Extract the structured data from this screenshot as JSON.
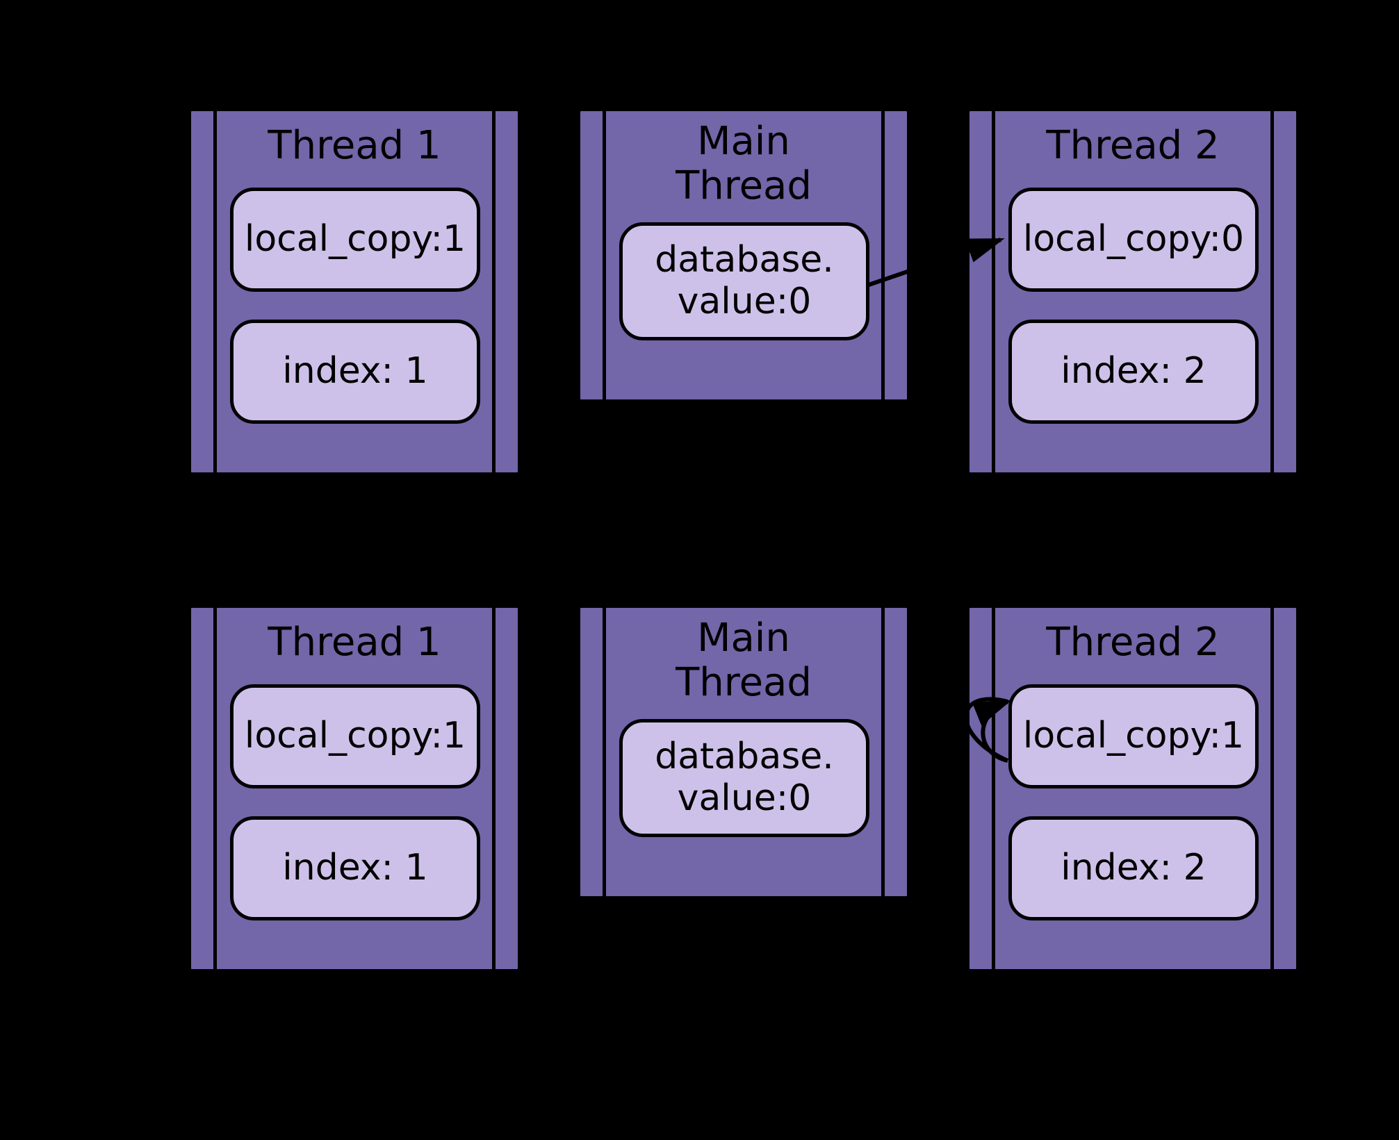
{
  "rows": [
    {
      "thread1": {
        "title": "Thread 1",
        "local_copy": "local_copy:1",
        "index": "index: 1"
      },
      "main": {
        "title": "Main\nThread",
        "db": "database.\nvalue:0"
      },
      "thread2": {
        "title": "Thread 2",
        "local_copy": "local_copy:0",
        "index": "index: 2"
      }
    },
    {
      "thread1": {
        "title": "Thread 1",
        "local_copy": "local_copy:1",
        "index": "index: 1"
      },
      "main": {
        "title": "Main\nThread",
        "db": "database.\nvalue:0"
      },
      "thread2": {
        "title": "Thread 2",
        "local_copy": "local_copy:1",
        "index": "index: 2"
      }
    }
  ]
}
